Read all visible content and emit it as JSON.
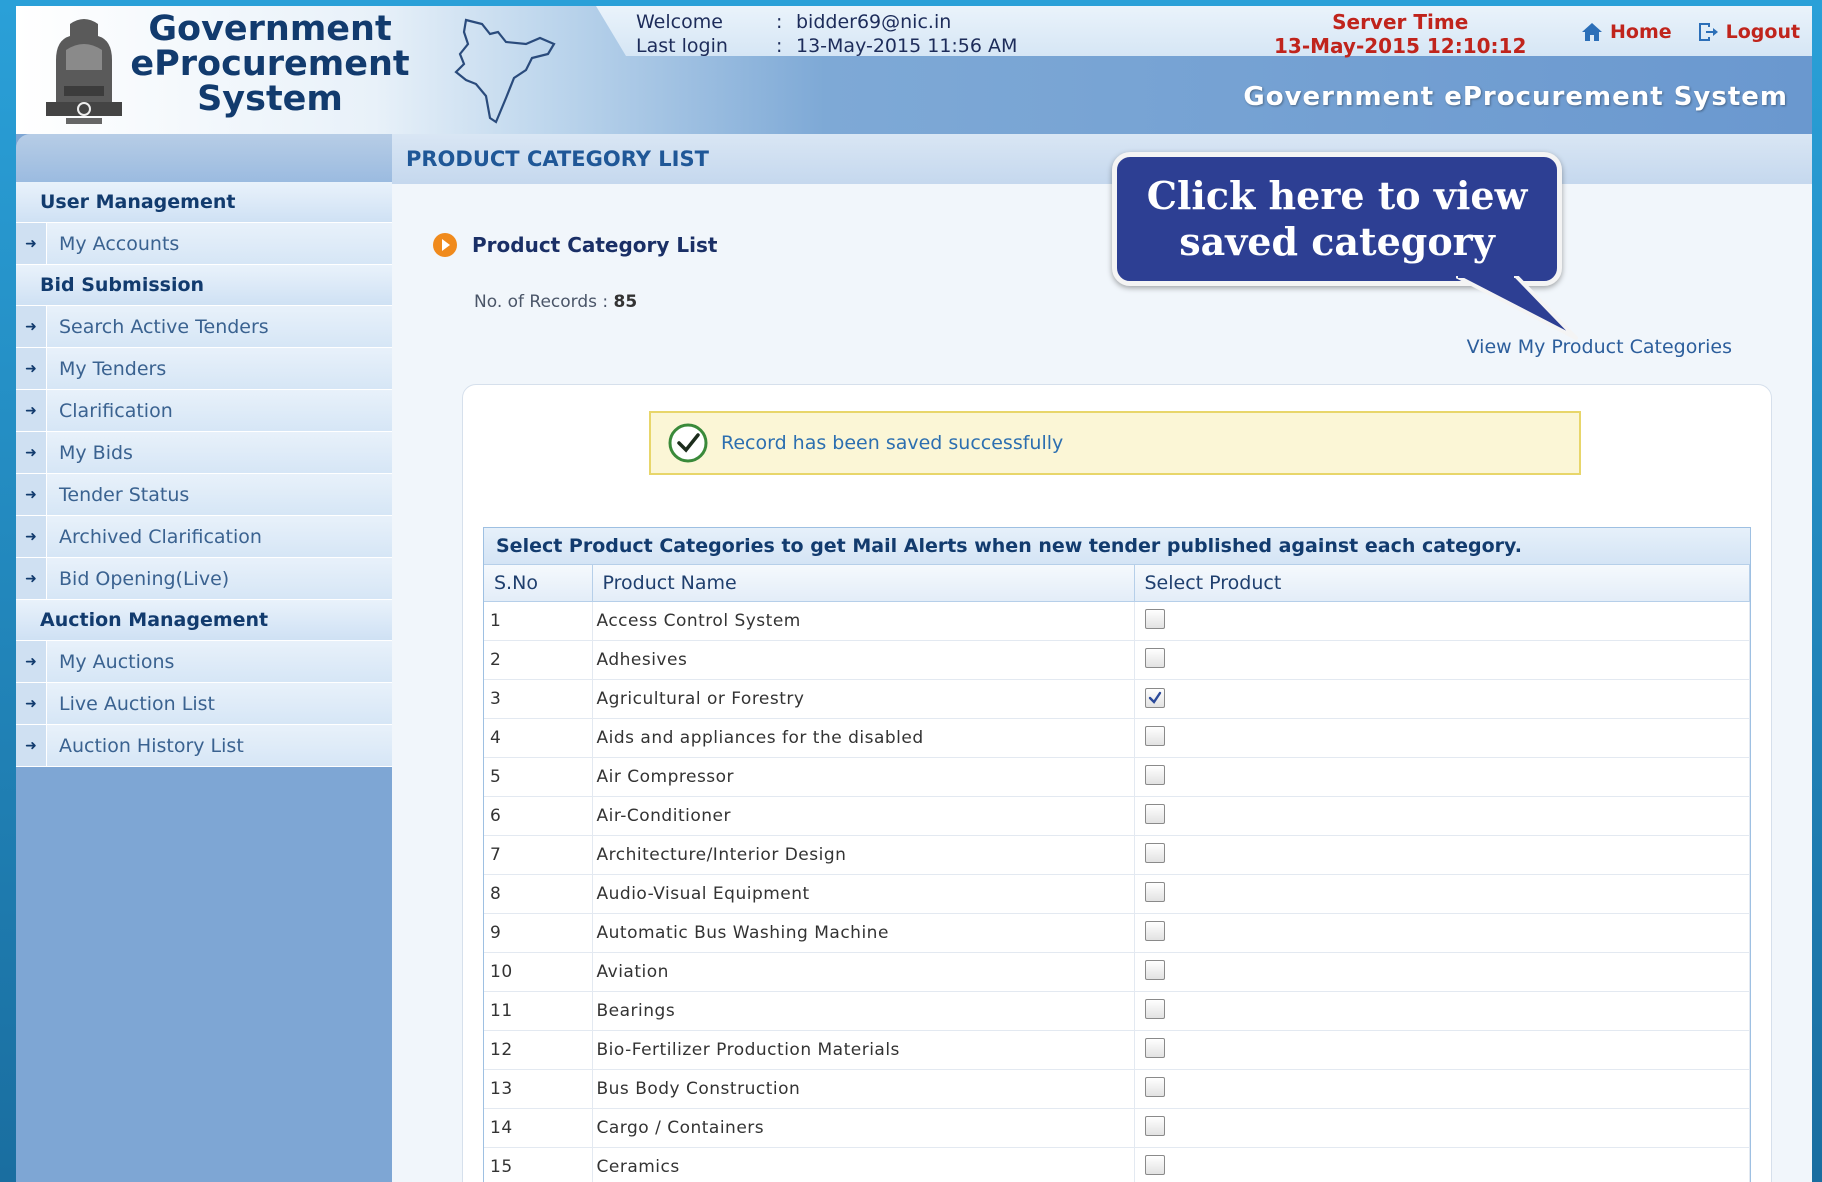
{
  "header": {
    "logo_lines": [
      "Government",
      "eProcurement",
      "System"
    ],
    "welcome_label": "Welcome",
    "welcome_value": "bidder69@nic.in",
    "last_login_label": "Last login",
    "last_login_value": "13-May-2015 11:56 AM",
    "separator": ":",
    "server_time_label": "Server Time",
    "server_time_value": "13-May-2015 12:10:12",
    "home_label": "Home",
    "logout_label": "Logout",
    "tagline": "Government eProcurement System"
  },
  "sidebar": {
    "sections": [
      {
        "title": "User Management",
        "items": [
          "My Accounts"
        ]
      },
      {
        "title": "Bid Submission",
        "items": [
          "Search Active Tenders",
          "My Tenders",
          "Clarification",
          "My Bids",
          "Tender Status",
          "Archived Clarification",
          "Bid Opening(Live)"
        ]
      },
      {
        "title": "Auction Management",
        "items": [
          "My Auctions",
          "Live Auction List",
          "Auction History List"
        ]
      }
    ]
  },
  "main": {
    "page_title": "PRODUCT CATEGORY LIST",
    "sub_heading": "Product Category List",
    "records_label": "No. of Records : ",
    "records_count": "85",
    "view_link": "View My Product Categories",
    "success_message": "Record has been saved successfully",
    "table_caption": "Select Product Categories to get Mail Alerts when new tender published against each category.",
    "columns": [
      "S.No",
      "Product Name",
      "Select Product"
    ],
    "rows": [
      {
        "sno": "1",
        "name": "Access Control System",
        "checked": false
      },
      {
        "sno": "2",
        "name": "Adhesives",
        "checked": false
      },
      {
        "sno": "3",
        "name": "Agricultural or Forestry",
        "checked": true
      },
      {
        "sno": "4",
        "name": "Aids and appliances for the disabled",
        "checked": false
      },
      {
        "sno": "5",
        "name": "Air Compressor",
        "checked": false
      },
      {
        "sno": "6",
        "name": "Air-Conditioner",
        "checked": false
      },
      {
        "sno": "7",
        "name": "Architecture/Interior Design",
        "checked": false
      },
      {
        "sno": "8",
        "name": "Audio-Visual Equipment",
        "checked": false
      },
      {
        "sno": "9",
        "name": "Automatic Bus Washing Machine",
        "checked": false
      },
      {
        "sno": "10",
        "name": "Aviation",
        "checked": false
      },
      {
        "sno": "11",
        "name": "Bearings",
        "checked": false
      },
      {
        "sno": "12",
        "name": "Bio-Fertilizer Production Materials",
        "checked": false
      },
      {
        "sno": "13",
        "name": "Bus Body Construction",
        "checked": false
      },
      {
        "sno": "14",
        "name": "Cargo / Containers",
        "checked": false
      },
      {
        "sno": "15",
        "name": "Ceramics",
        "checked": false
      }
    ]
  },
  "callout": {
    "lines": [
      "Click here to view",
      "saved category"
    ]
  },
  "icons": {
    "home": "home-icon",
    "logout": "logout-icon",
    "emblem": "national-emblem-icon",
    "map": "india-map-icon",
    "bullet": "orange-arrow-icon",
    "success": "check-circle-icon",
    "sidebar_arrow": "arrow-right-icon"
  },
  "colors": {
    "accent": "#c0241c",
    "brand": "#123b6e",
    "callout_bg": "#2d3f93",
    "success_bg": "#fbf6d6"
  }
}
